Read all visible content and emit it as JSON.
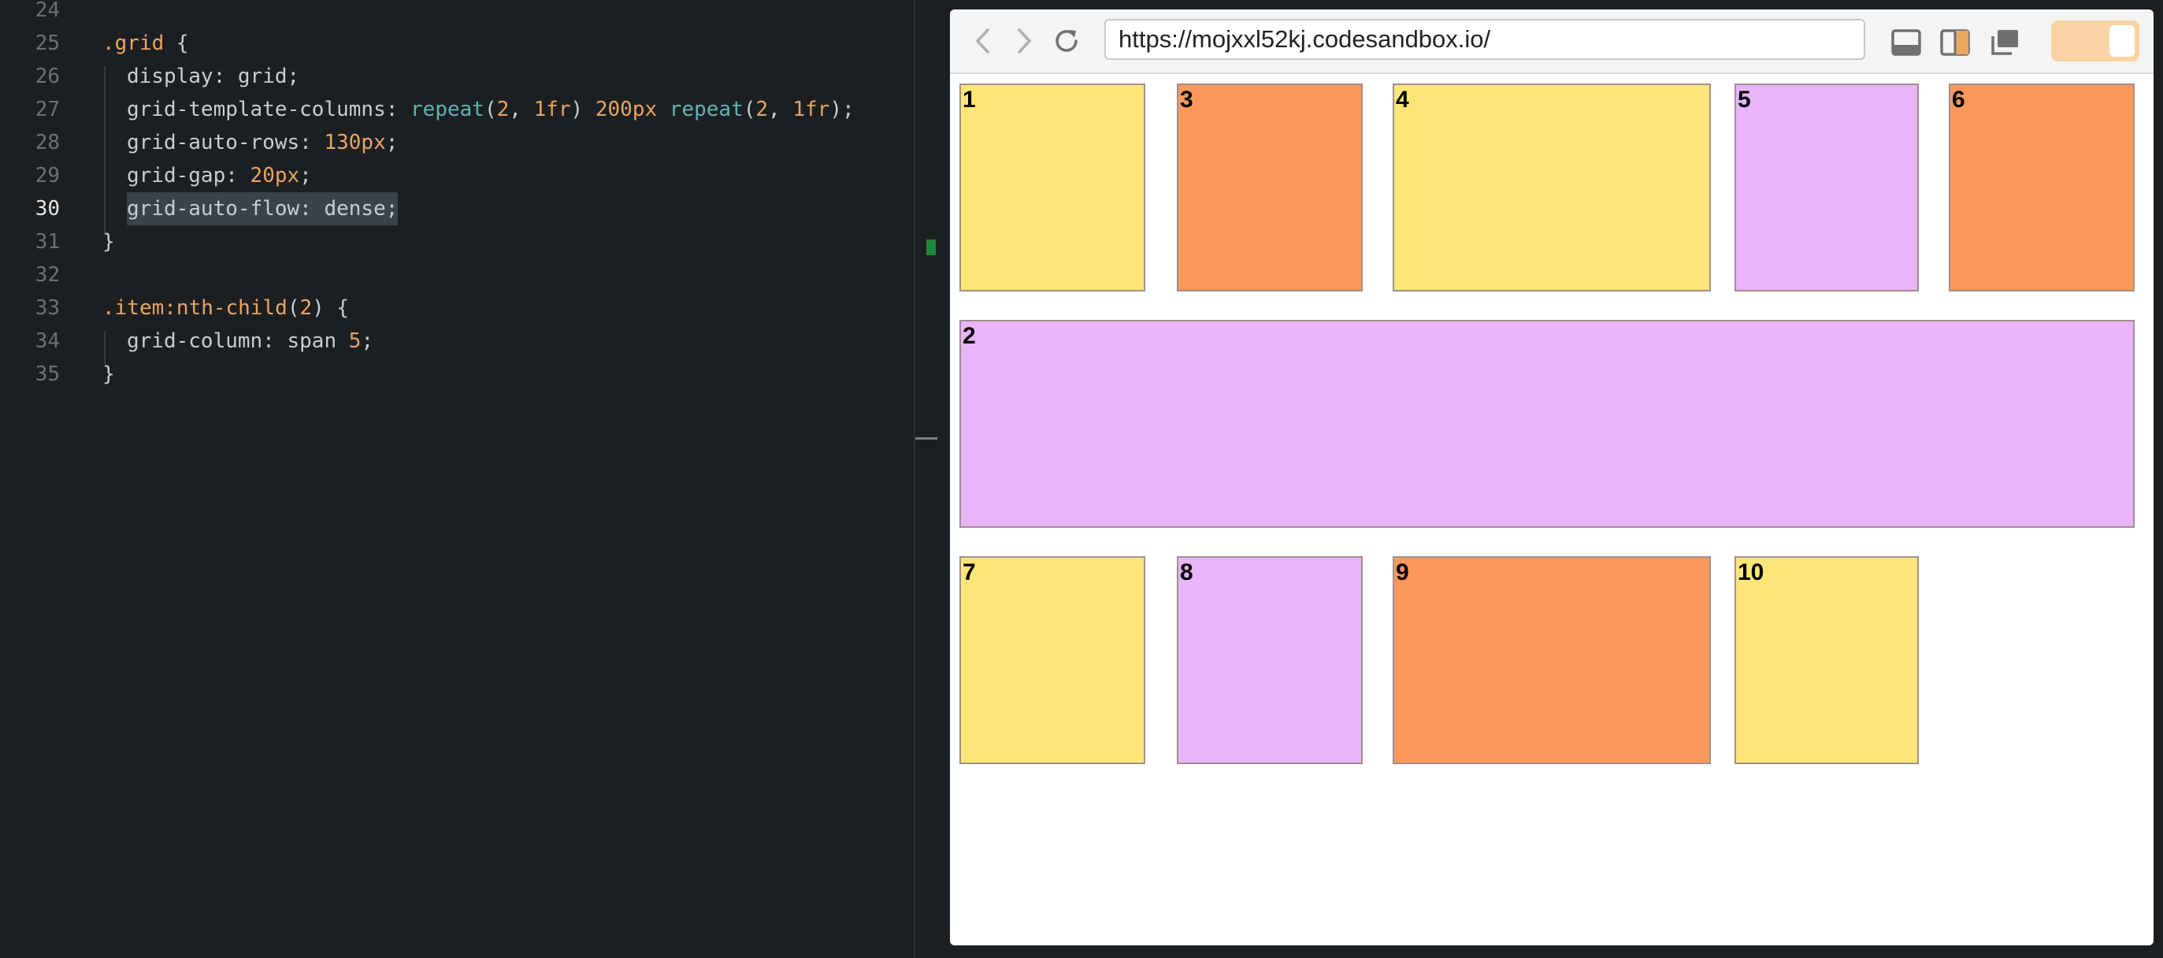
{
  "editor": {
    "lines": [
      {
        "n": "24",
        "tokens": []
      },
      {
        "n": "25",
        "tokens": [
          [
            "sel",
            ".grid"
          ],
          [
            "punc",
            " {"
          ]
        ]
      },
      {
        "n": "26",
        "tokens": [
          [
            "prop",
            "display: "
          ],
          [
            "val",
            "grid"
          ],
          [
            "punc",
            ";"
          ]
        ]
      },
      {
        "n": "27",
        "tokens": [
          [
            "prop",
            "grid-template-columns: "
          ],
          [
            "fn",
            "repeat"
          ],
          [
            "punc",
            "("
          ],
          [
            "num",
            "2"
          ],
          [
            "punc",
            ", "
          ],
          [
            "num",
            "1fr"
          ],
          [
            "punc",
            ") "
          ],
          [
            "num",
            "200px"
          ],
          [
            "punc",
            " "
          ],
          [
            "fn",
            "repeat"
          ],
          [
            "punc",
            "("
          ],
          [
            "num",
            "2"
          ],
          [
            "punc",
            ", "
          ],
          [
            "num",
            "1fr"
          ],
          [
            "punc",
            ");"
          ]
        ]
      },
      {
        "n": "28",
        "tokens": [
          [
            "prop",
            "grid-auto-rows: "
          ],
          [
            "num",
            "130px"
          ],
          [
            "punc",
            ";"
          ]
        ]
      },
      {
        "n": "29",
        "tokens": [
          [
            "prop",
            "grid-gap: "
          ],
          [
            "num",
            "20px"
          ],
          [
            "punc",
            ";"
          ]
        ]
      },
      {
        "n": "30",
        "tokens": [
          [
            "prop",
            "grid-auto-flow: dense;"
          ]
        ]
      },
      {
        "n": "31",
        "tokens": [
          [
            "punc",
            "}"
          ]
        ]
      },
      {
        "n": "32",
        "tokens": []
      },
      {
        "n": "33",
        "tokens": [
          [
            "sel",
            ".item:nth-child"
          ],
          [
            "punc",
            "("
          ],
          [
            "num",
            "2"
          ],
          [
            "punc",
            ") {"
          ]
        ]
      },
      {
        "n": "34",
        "tokens": [
          [
            "prop",
            "grid-column: "
          ],
          [
            "val",
            "span "
          ],
          [
            "num",
            "5"
          ],
          [
            "punc",
            ";"
          ]
        ]
      },
      {
        "n": "35",
        "tokens": [
          [
            "punc",
            "}"
          ]
        ]
      }
    ],
    "active_line": "30"
  },
  "browser": {
    "url": "https://mojxxl52kj.codesandbox.io/",
    "icons": [
      "back-arrow-icon",
      "forward-arrow-icon",
      "reload-icon",
      "dock-bottom-icon",
      "dock-side-icon",
      "new-window-icon"
    ]
  },
  "grid_items": [
    {
      "label": "1",
      "color": "yellow"
    },
    {
      "label": "3",
      "color": "orange"
    },
    {
      "label": "4",
      "color": "yellow"
    },
    {
      "label": "5",
      "color": "purple"
    },
    {
      "label": "6",
      "color": "orange"
    },
    {
      "label": "2",
      "color": "purple"
    },
    {
      "label": "7",
      "color": "yellow"
    },
    {
      "label": "8",
      "color": "purple"
    },
    {
      "label": "9",
      "color": "orange"
    },
    {
      "label": "10",
      "color": "yellow"
    }
  ],
  "colors": {
    "yellow": "#fde677",
    "orange": "#fc995a",
    "purple": "#e8b4fb"
  }
}
